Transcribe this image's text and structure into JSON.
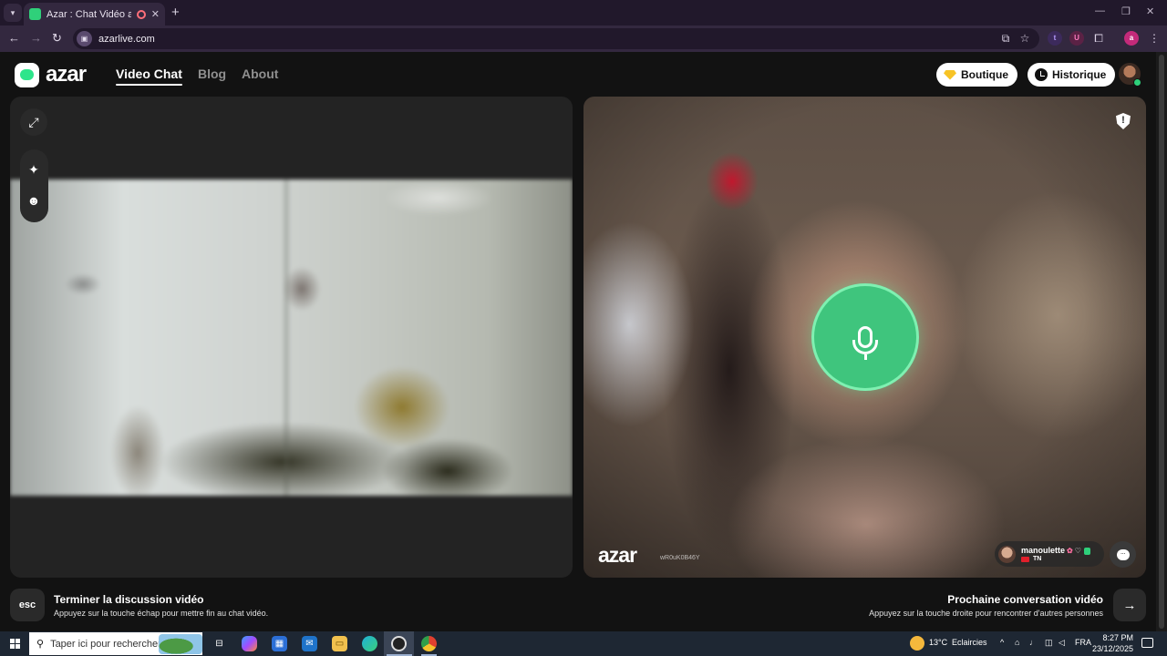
{
  "browser": {
    "tab_title": "Azar : Chat Vidéo avec de n",
    "url": "azarlive.com",
    "new_tab_label": "+",
    "close_tab_label": "✕",
    "extensions": [
      "t",
      "U",
      "a"
    ]
  },
  "header": {
    "logo_text": "azar",
    "nav": [
      {
        "label": "Video Chat",
        "active": true
      },
      {
        "label": "Blog",
        "active": false
      },
      {
        "label": "About",
        "active": false
      }
    ],
    "boutique_label": "Boutique",
    "historique_label": "Historique"
  },
  "remote": {
    "watermark": "azar",
    "watermark_id": "wR0uK0B46Y",
    "username": "manoulette",
    "country": "TN",
    "shield_symbol": "!"
  },
  "bottom": {
    "esc_key": "esc",
    "end_title": "Terminer la discussion vidéo",
    "end_sub": "Appuyez sur la touche échap pour mettre fin au chat vidéo.",
    "next_title": "Prochaine conversation vidéo",
    "next_sub": "Appuyez sur la touche droite pour rencontrer d'autres personnes",
    "next_arrow": "→"
  },
  "taskbar": {
    "search_placeholder": "Taper ici pour rechercher",
    "weather_temp": "13°C",
    "weather_desc": "Eclaircies",
    "language": "FRA",
    "time": "8:27 PM",
    "date": "23/12/2025"
  },
  "colors": {
    "accent_green": "#3fc57d",
    "page_bg": "#121212",
    "panel_bg": "#232323",
    "browser_bg": "#33283f"
  }
}
